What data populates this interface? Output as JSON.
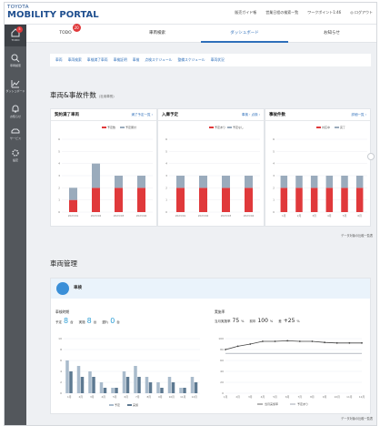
{
  "app": {
    "logo_top": "TOYOTA",
    "logo_bottom": "MOBILITY PORTAL",
    "header_links": [
      "販売ガイド帳",
      "営業日程の検索一覧",
      "ワークポイント1:46",
      "◎ ログアウト"
    ]
  },
  "sidebar": {
    "badge": "5",
    "items": [
      {
        "label": "TODO",
        "icon": "home-icon"
      },
      {
        "label": "車両検索",
        "icon": "search-icon"
      },
      {
        "label": "ダッシュボード",
        "icon": "chart-icon"
      },
      {
        "label": "お知らせ",
        "icon": "bell-icon"
      },
      {
        "label": "サービス",
        "icon": "car-icon"
      },
      {
        "label": "設定",
        "icon": "gear-icon"
      }
    ]
  },
  "tabs": [
    {
      "label": "TODO",
      "badge": "20",
      "active": false
    },
    {
      "label": "車両検索",
      "active": false
    },
    {
      "label": "ダッシュボード",
      "active": true
    },
    {
      "label": "お知らせ",
      "active": false
    }
  ],
  "quicklinks": [
    "車両",
    "車両検索",
    "車検満了車両",
    "車検証明",
    "車検",
    "点検スケジュール",
    "整備スケジュール",
    "車両状況"
  ],
  "section1": {
    "title": "車両&事故件数",
    "subtitle": "(社用車別)"
  },
  "cards": [
    {
      "title": "契約満了車両",
      "link": "満了予定一覧 ›",
      "legend": [
        "予定数",
        "予定累計"
      ]
    },
    {
      "title": "入庫予定",
      "link": "車検・点検 ›",
      "legend": [
        "予定あり",
        "予定なし"
      ]
    },
    {
      "title": "事故件数",
      "link": "詳細一覧 ›",
      "legend": [
        "対応中",
        "完了"
      ]
    }
  ],
  "section1_footer": "データ対象の比較一覧表",
  "section2": {
    "title": "車両管理"
  },
  "mgmt": {
    "name": "車検",
    "left_label": "車検時期",
    "stats_left": [
      {
        "prefix": "予定",
        "value": "8",
        "unit": "台"
      },
      {
        "prefix": "実施",
        "value": "8",
        "unit": "台"
      },
      {
        "prefix": "遅れ",
        "value": "0",
        "unit": "台"
      }
    ],
    "right_label": "実施率",
    "stats_right": [
      {
        "prefix": "当月実施率",
        "value": "75",
        "unit": "%"
      },
      {
        "prefix": "前年",
        "value": "100",
        "unit": "%"
      },
      {
        "prefix": "差",
        "value": "+25",
        "unit": "%"
      }
    ],
    "legend_left": [
      "予定",
      "実施"
    ],
    "legend_right": [
      "当月実施率",
      "予定あり"
    ],
    "footer": "データ対象の比較一覧表"
  },
  "chart_data": [
    {
      "type": "bar",
      "title": "契約満了車両",
      "categories": [
        "2023/01",
        "2023/02",
        "2023/03",
        "2023/04"
      ],
      "series": [
        {
          "name": "予定数",
          "values": [
            1,
            2,
            2,
            2
          ]
        },
        {
          "name": "予定累計",
          "values": [
            1,
            2,
            1,
            1
          ]
        }
      ],
      "ylim": [
        0,
        6
      ],
      "colors": [
        "#e0393b",
        "#9aabbc"
      ]
    },
    {
      "type": "bar",
      "title": "入庫予定",
      "categories": [
        "2023/01",
        "2023/02",
        "2023/03",
        "2023/04"
      ],
      "series": [
        {
          "name": "予定あり",
          "values": [
            2,
            2,
            2,
            2
          ]
        },
        {
          "name": "予定なし",
          "values": [
            1,
            1,
            1,
            1
          ]
        }
      ],
      "ylim": [
        0,
        6
      ],
      "colors": [
        "#e0393b",
        "#9aabbc"
      ]
    },
    {
      "type": "bar",
      "title": "事故件数",
      "categories": [
        "1月",
        "2月",
        "3月",
        "4月",
        "5月",
        "6月"
      ],
      "series": [
        {
          "name": "対応中",
          "values": [
            2,
            2,
            2,
            2,
            2,
            2
          ]
        },
        {
          "name": "完了",
          "values": [
            1,
            1,
            1,
            1,
            1,
            1
          ]
        }
      ],
      "ylim": [
        0,
        6
      ],
      "colors": [
        "#e0393b",
        "#9aabbc"
      ]
    },
    {
      "type": "bar",
      "title": "車検時期",
      "categories": [
        "1月",
        "2月",
        "3月",
        "4月",
        "5月",
        "6月",
        "7月",
        "8月",
        "9月",
        "10月",
        "11月",
        "12月"
      ],
      "series": [
        {
          "name": "予定",
          "values": [
            6,
            5,
            4,
            2,
            1,
            4,
            5,
            3,
            2,
            3,
            1,
            3
          ]
        },
        {
          "name": "実施",
          "values": [
            4,
            3,
            3,
            1,
            1,
            3,
            3,
            2,
            1,
            2,
            1,
            2
          ]
        }
      ],
      "ylim": [
        0,
        10
      ],
      "colors": [
        "#a9bbcc",
        "#5d7991"
      ]
    },
    {
      "type": "line",
      "title": "実施率",
      "categories": [
        "1月",
        "2月",
        "3月",
        "4月",
        "5月",
        "6月",
        "7月",
        "8月",
        "9月",
        "10月",
        "11月",
        "12月"
      ],
      "series": [
        {
          "name": "当月実施率",
          "values": [
            80,
            86,
            90,
            95,
            95,
            96,
            95,
            95,
            93,
            92,
            92,
            92
          ]
        },
        {
          "name": "予定あり",
          "values": [
            73,
            73,
            73,
            73,
            73,
            73,
            73,
            73,
            73,
            73,
            73,
            73
          ]
        }
      ],
      "ylim": [
        0,
        100
      ],
      "colors": [
        "#444444",
        "#8c95a0"
      ]
    }
  ]
}
